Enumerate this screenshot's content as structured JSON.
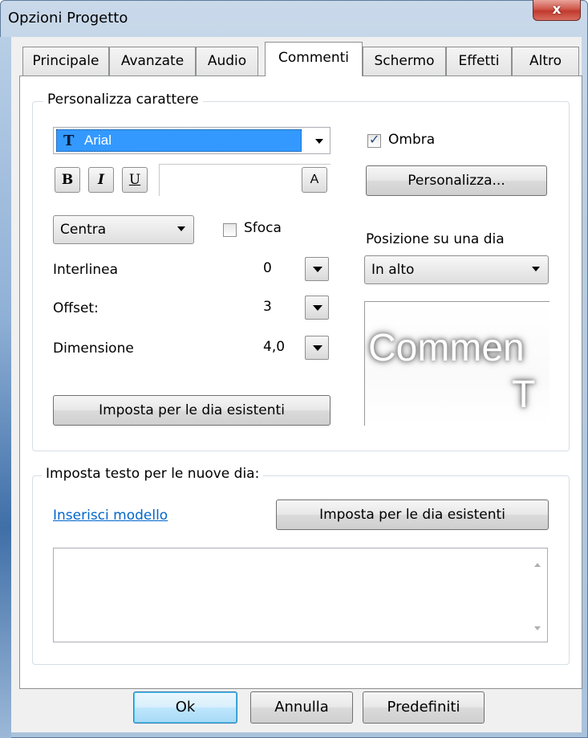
{
  "window": {
    "title": "Opzioni Progetto",
    "close_glyph": "x"
  },
  "tabs": [
    {
      "label": "Principale",
      "active": false
    },
    {
      "label": "Avanzate",
      "active": false
    },
    {
      "label": "Audio",
      "active": false
    },
    {
      "label": "Commenti",
      "active": true
    },
    {
      "label": "Schermo",
      "active": false
    },
    {
      "label": "Effetti",
      "active": false
    },
    {
      "label": "Altro",
      "active": false
    }
  ],
  "font_group": {
    "legend": "Personalizza carattere",
    "font_icon": "T",
    "font_name": "Arial",
    "bold": "B",
    "italic": "I",
    "underline": "U",
    "color_button": "A",
    "shadow_label": "Ombra",
    "shadow_checked": true,
    "customize_button": "Personalizza...",
    "align_value": "Centra",
    "blur_label": "Sfoca",
    "blur_checked": false,
    "position_label": "Posizione su una dia",
    "position_value": "In alto",
    "interline_label": "Interlinea",
    "interline_value": "0",
    "offset_label": "Offset:",
    "offset_value": "3",
    "size_label": "Dimensione",
    "size_value": "4,0",
    "apply_existing_button": "Imposta per le dia esistenti",
    "preview_line1": "Commen",
    "preview_line2": "T"
  },
  "text_group": {
    "legend": "Imposta testo per le nuove dia:",
    "insert_template_link": "Inserisci modello",
    "apply_existing_button": "Imposta per le dia esistenti",
    "text_value": ""
  },
  "footer": {
    "ok": "Ok",
    "cancel": "Annulla",
    "defaults": "Predefiniti"
  },
  "colors": {
    "accent_select": "#3399ff",
    "link": "#0066cc",
    "close_red": "#c03a2e"
  }
}
